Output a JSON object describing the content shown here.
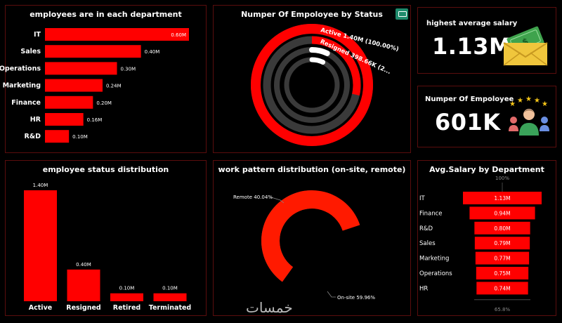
{
  "colors": {
    "accent": "#ff0000",
    "ring_track": "#3a3a3a",
    "remote": "#595959",
    "onsite": "#ff1a00",
    "panel_border": "#5a0d0d"
  },
  "dept_panel": {
    "title": "employees are in each department",
    "chart_data": {
      "type": "bar",
      "orientation": "horizontal",
      "categories": [
        "IT",
        "Sales",
        "Operations",
        "Marketing",
        "Finance",
        "HR",
        "R&D"
      ],
      "values": [
        0.6,
        0.4,
        0.3,
        0.24,
        0.2,
        0.16,
        0.1
      ],
      "data_labels": [
        "0.60M",
        "0.40M",
        "0.30M",
        "0.24M",
        "0.20M",
        "0.16M",
        "0.10M"
      ],
      "unit": "M"
    }
  },
  "status_ring_panel": {
    "title": "Numper Of Empoloyee by Status",
    "icon": "comment-icon",
    "chart_data": {
      "type": "radial-bar",
      "series": [
        {
          "label": "Active 1.40M (100.00%)",
          "value": 1.4,
          "percent": 100.0
        },
        {
          "label": "Resigned 398.66K (2...",
          "value": 0.39866,
          "percent": 28.5
        },
        {
          "label": "",
          "value": 0.1,
          "percent": 7.1
        },
        {
          "label": "",
          "value": 0.1,
          "percent": 7.1
        }
      ]
    }
  },
  "kpi_salary": {
    "title": "highest average salary",
    "value": "1.13M",
    "icon": "money-envelope-icon"
  },
  "kpi_employees": {
    "title": "Numper Of Empoloyee",
    "value": "601K",
    "icon": "rated-employee-icon"
  },
  "status_dist_panel": {
    "title": "employee status distribution",
    "chart_data": {
      "type": "bar",
      "categories": [
        "Active",
        "Resigned",
        "Retired",
        "Terminated"
      ],
      "values": [
        1.4,
        0.4,
        0.1,
        0.1
      ],
      "data_labels": [
        "1.40M",
        "0.40M",
        "0.10M",
        "0.10M"
      ],
      "unit": "M"
    }
  },
  "work_pattern_panel": {
    "title": "work pattern distribution (on-site, remote)",
    "chart_data": {
      "type": "pie",
      "donut": true,
      "slices": [
        {
          "label": "Remote 40.04%",
          "value": 40.04,
          "color": "#595959"
        },
        {
          "label": "On-site 59.96%",
          "value": 59.96,
          "color": "#ff1a00"
        }
      ]
    }
  },
  "avg_salary_panel": {
    "title": "Avg.Salary by Department",
    "chart_data": {
      "type": "funnel",
      "categories": [
        "IT",
        "Finance",
        "R&D",
        "Sales",
        "Marketing",
        "Operations",
        "HR"
      ],
      "values": [
        1.13,
        0.94,
        0.8,
        0.79,
        0.77,
        0.75,
        0.74
      ],
      "data_labels": [
        "1.13M",
        "0.94M",
        "0.80M",
        "0.79M",
        "0.77M",
        "0.75M",
        "0.74M"
      ],
      "top_label": "100%",
      "bottom_label": "65.8%"
    }
  },
  "watermark": "خمسات"
}
